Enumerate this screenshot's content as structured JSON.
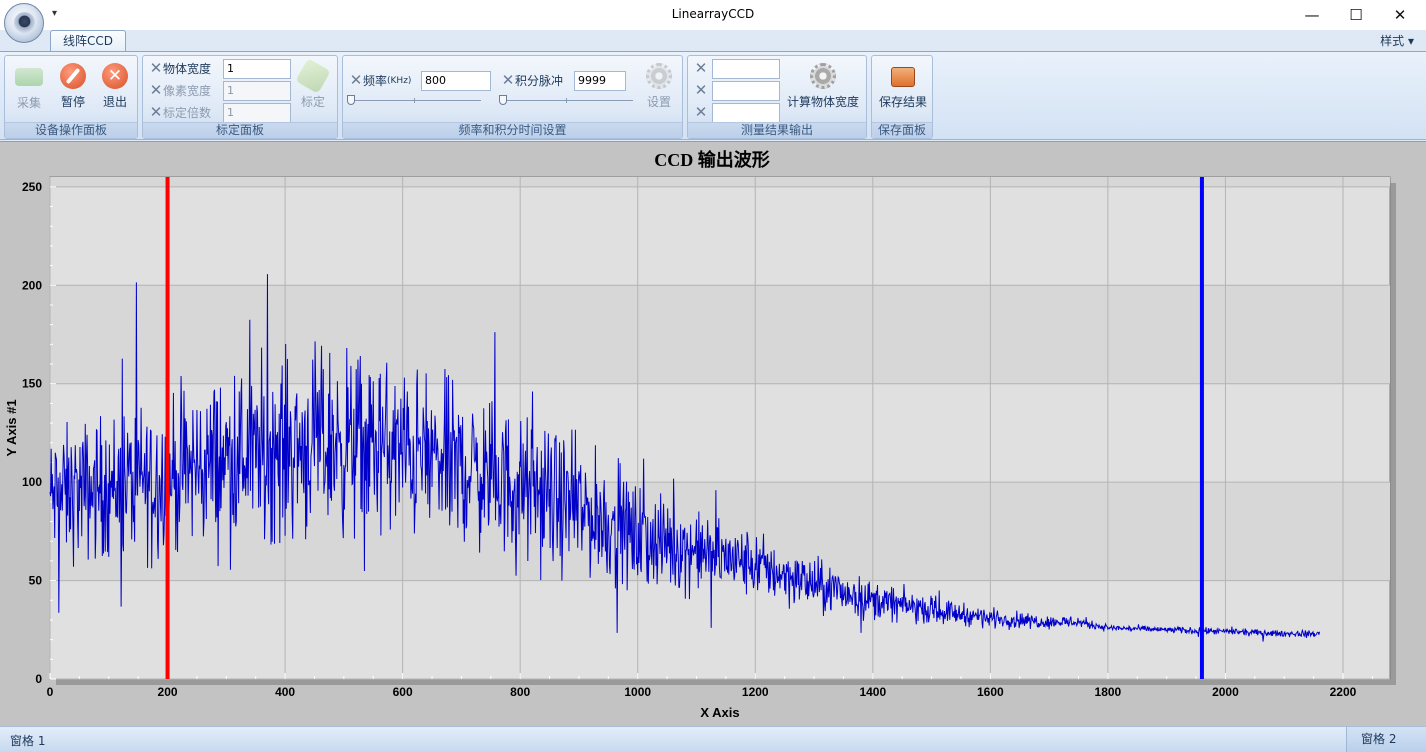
{
  "window": {
    "title": "LinearrayCCD",
    "qat_glyph": "▾",
    "minimize": "—",
    "maximize": "☐",
    "close": "✕"
  },
  "ribbon": {
    "tab": "线阵CCD",
    "style_menu": "样式 ▾",
    "groups": {
      "device": {
        "label": "设备操作面板",
        "capture": "采集",
        "pause": "暂停",
        "exit": "退出"
      },
      "calibration": {
        "label": "标定面板",
        "object_width_label": "物体宽度",
        "object_width_value": "1",
        "pixel_width_label": "像素宽度",
        "pixel_width_value": "1",
        "calib_multiple_label": "标定倍数",
        "calib_multiple_value": "1",
        "calibrate": "标定"
      },
      "frequency": {
        "label": "频率和积分时间设置",
        "freq_label": "频率",
        "freq_unit": "(KHz)",
        "freq_value": "800",
        "pulse_label": "积分脉冲",
        "pulse_value": "9999",
        "settings": "设置"
      },
      "results": {
        "label": "测量结果输出",
        "result1": "",
        "result2": "",
        "result3": "",
        "compute": "计算物体宽度"
      },
      "save": {
        "label": "保存面板",
        "save_result": "保存结果"
      }
    }
  },
  "chart_data": {
    "type": "line",
    "title": "CCD 输出波形",
    "xlabel": "X Axis",
    "ylabel": "Y Axis #1",
    "xlim": [
      0,
      2280
    ],
    "ylim": [
      0,
      255
    ],
    "xticks": [
      0,
      200,
      400,
      600,
      800,
      1000,
      1200,
      1400,
      1600,
      1800,
      2000,
      2200
    ],
    "yticks": [
      0,
      50,
      100,
      150,
      200,
      250
    ],
    "grid": true,
    "cursors": [
      {
        "x": 200,
        "color": "#ff0000"
      },
      {
        "x": 1960,
        "color": "#0000ff"
      }
    ],
    "series": [
      {
        "color": "#0000c8",
        "envelope_x": [
          0,
          100,
          200,
          300,
          400,
          500,
          600,
          700,
          800,
          900,
          1000,
          1100,
          1200,
          1300,
          1400,
          1500,
          1600,
          1700,
          1750,
          1800,
          1900,
          2000,
          2100,
          2160
        ],
        "envelope_y": [
          92,
          98,
          103,
          112,
          118,
          120,
          115,
          108,
          97,
          86,
          72,
          65,
          58,
          48,
          40,
          35,
          31,
          29,
          29,
          26,
          25,
          24,
          23,
          23
        ],
        "noise_amplitude": [
          20,
          22,
          24,
          26,
          28,
          28,
          26,
          24,
          22,
          20,
          16,
          12,
          10,
          8,
          6,
          4,
          3,
          2,
          2,
          1,
          1,
          1,
          1,
          1
        ]
      }
    ]
  },
  "status": {
    "pane1": "窗格 1",
    "pane2": "窗格 2"
  }
}
